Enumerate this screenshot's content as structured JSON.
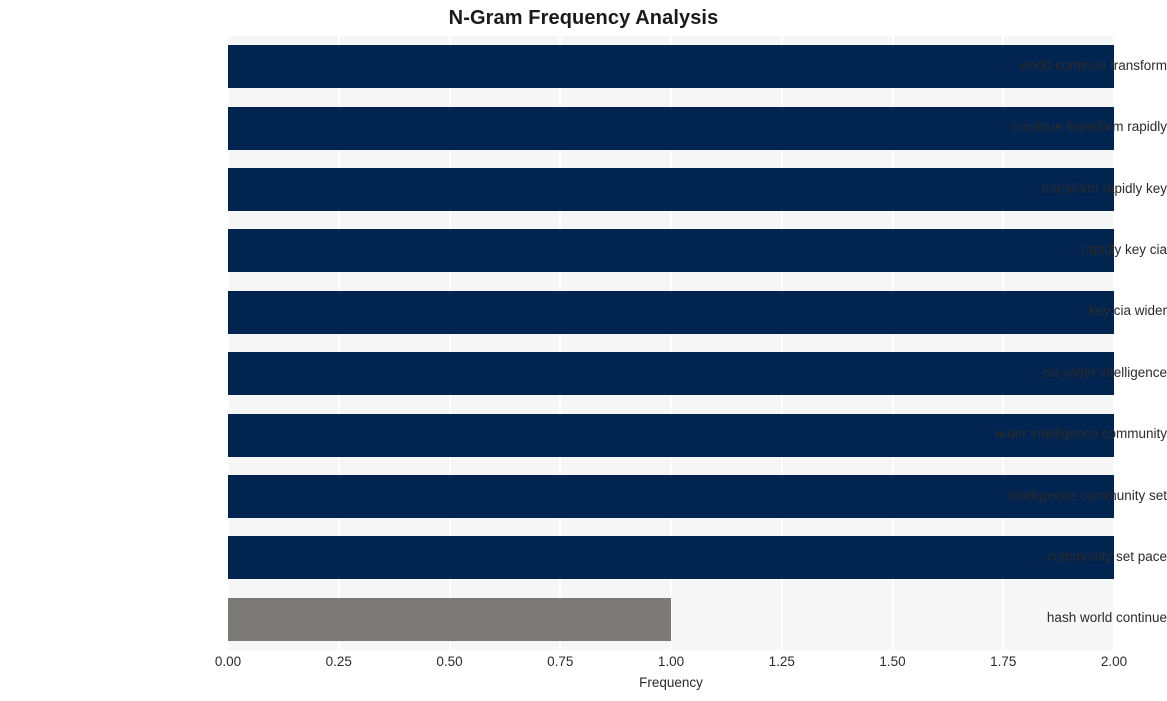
{
  "chart_data": {
    "type": "bar",
    "orientation": "horizontal",
    "title": "N-Gram Frequency Analysis",
    "xlabel": "Frequency",
    "ylabel": "",
    "categories": [
      "world continue transform",
      "continue transform rapidly",
      "transform rapidly key",
      "rapidly key cia",
      "key cia wider",
      "cia wider intelligence",
      "wider intelligence community",
      "intelligence community set",
      "community set pace",
      "hash world continue"
    ],
    "values": [
      2,
      2,
      2,
      2,
      2,
      2,
      2,
      2,
      2,
      1
    ],
    "bar_colors": [
      "#012450",
      "#012450",
      "#012450",
      "#012450",
      "#012450",
      "#012450",
      "#012450",
      "#012450",
      "#012450",
      "#7b7a78"
    ],
    "xlim": [
      0,
      2
    ],
    "xticks": [
      0,
      0.25,
      0.5,
      0.75,
      1,
      1.25,
      1.5,
      1.75,
      2
    ],
    "xtick_labels": [
      "0.00",
      "0.25",
      "0.50",
      "0.75",
      "1.00",
      "1.25",
      "1.50",
      "1.75",
      "2.00"
    ],
    "grid": true,
    "grid_axis": "x",
    "grid_color": "#ffffff",
    "plot_background": "#f6f6f7",
    "figure_background": "#ffffff",
    "legend": null
  }
}
